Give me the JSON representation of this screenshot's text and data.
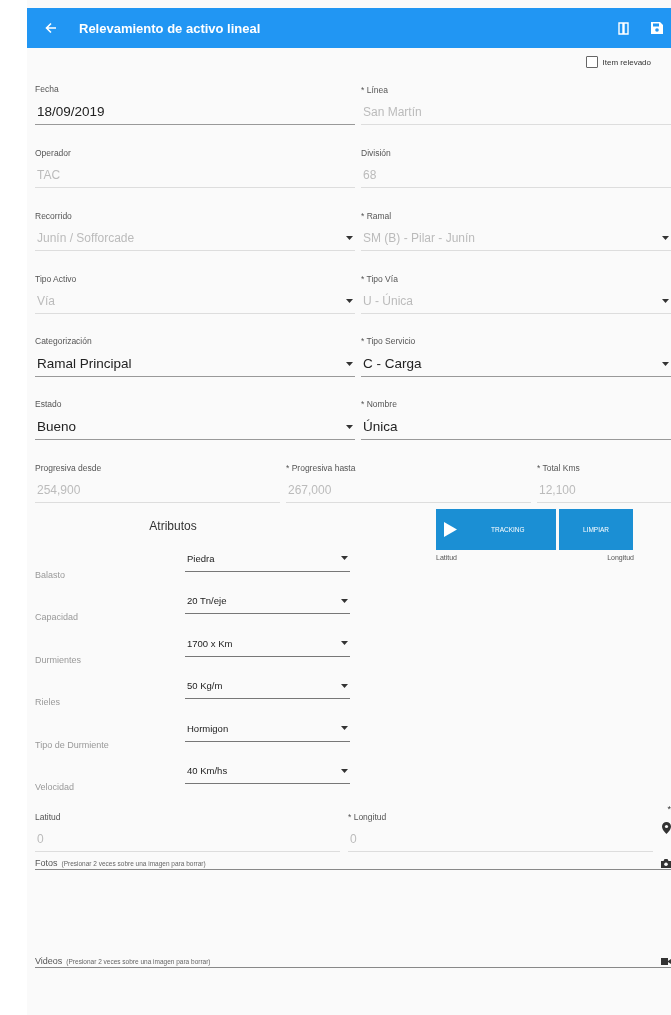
{
  "app_bar": {
    "title": "Relevamiento de activo lineal"
  },
  "item_relevado": {
    "label": "Item relevado",
    "checked": false
  },
  "rows": [
    {
      "fields": [
        {
          "label": "Fecha",
          "value": "18/09/2019",
          "kind": "text",
          "disabled": false
        },
        {
          "label": "* Línea",
          "value": "San Martín",
          "kind": "text",
          "disabled": true
        }
      ]
    },
    {
      "fields": [
        {
          "label": "Operador",
          "value": "TAC",
          "kind": "text",
          "disabled": true
        },
        {
          "label": "División",
          "value": "68",
          "kind": "text",
          "disabled": true
        }
      ]
    },
    {
      "fields": [
        {
          "label": "Recorrido",
          "value": "Junín / Sofforcade",
          "kind": "select",
          "disabled": true
        },
        {
          "label": "* Ramal",
          "value": "SM (B) - Pilar - Junín",
          "kind": "select",
          "disabled": true
        }
      ]
    },
    {
      "fields": [
        {
          "label": "Tipo Activo",
          "value": "Vía",
          "kind": "select",
          "disabled": true
        },
        {
          "label": "* Tipo Vía",
          "value": "U - Única",
          "kind": "select",
          "disabled": true
        }
      ]
    },
    {
      "fields": [
        {
          "label": "Categorización",
          "value": "Ramal Principal",
          "kind": "select",
          "disabled": false
        },
        {
          "label": "* Tipo Servicio",
          "value": "C - Carga",
          "kind": "select",
          "disabled": false
        }
      ]
    },
    {
      "fields": [
        {
          "label": "Estado",
          "value": "Bueno",
          "kind": "select",
          "disabled": false
        },
        {
          "label": "* Nombre",
          "value": "Única",
          "kind": "text",
          "disabled": false
        }
      ]
    },
    {
      "fields": [
        {
          "label": "Progresiva desde",
          "value": "254,900",
          "kind": "text",
          "disabled": true
        },
        {
          "label": "* Progresiva hasta",
          "value": "267,000",
          "kind": "text",
          "disabled": true
        },
        {
          "label": "* Total Kms",
          "value": "12,100",
          "kind": "text",
          "disabled": true
        }
      ]
    }
  ],
  "attributes": {
    "title": "Atributos",
    "items": [
      {
        "label": "Balasto",
        "value": "Piedra"
      },
      {
        "label": "Capacidad",
        "value": "20 Tn/eje"
      },
      {
        "label": "Durmientes",
        "value": "1700 x Km"
      },
      {
        "label": "Rieles",
        "value": "50 Kg/m"
      },
      {
        "label": "Tipo de Durmiente",
        "value": "Hormigon"
      },
      {
        "label": "Velocidad",
        "value": "40 Km/hs"
      }
    ]
  },
  "tracking": {
    "buttons": [
      "TRACKING",
      "LIMPIAR"
    ],
    "latitude_label": "Latitud",
    "longitude_label": "Longitud"
  },
  "geo": {
    "fields": [
      {
        "label": "Latitud",
        "value": "0",
        "disabled": true
      },
      {
        "label": "* Longitud",
        "value": "0",
        "disabled": true
      }
    ],
    "trailing_mark": "*"
  },
  "media": [
    {
      "title": "Fotos",
      "hint": "(Presionar 2 veces sobre una imagen para borrar)",
      "kind": "photo"
    },
    {
      "title": "Videos",
      "hint": "(Presionar 2 veces sobre una imagen para borrar)",
      "kind": "video"
    }
  ]
}
